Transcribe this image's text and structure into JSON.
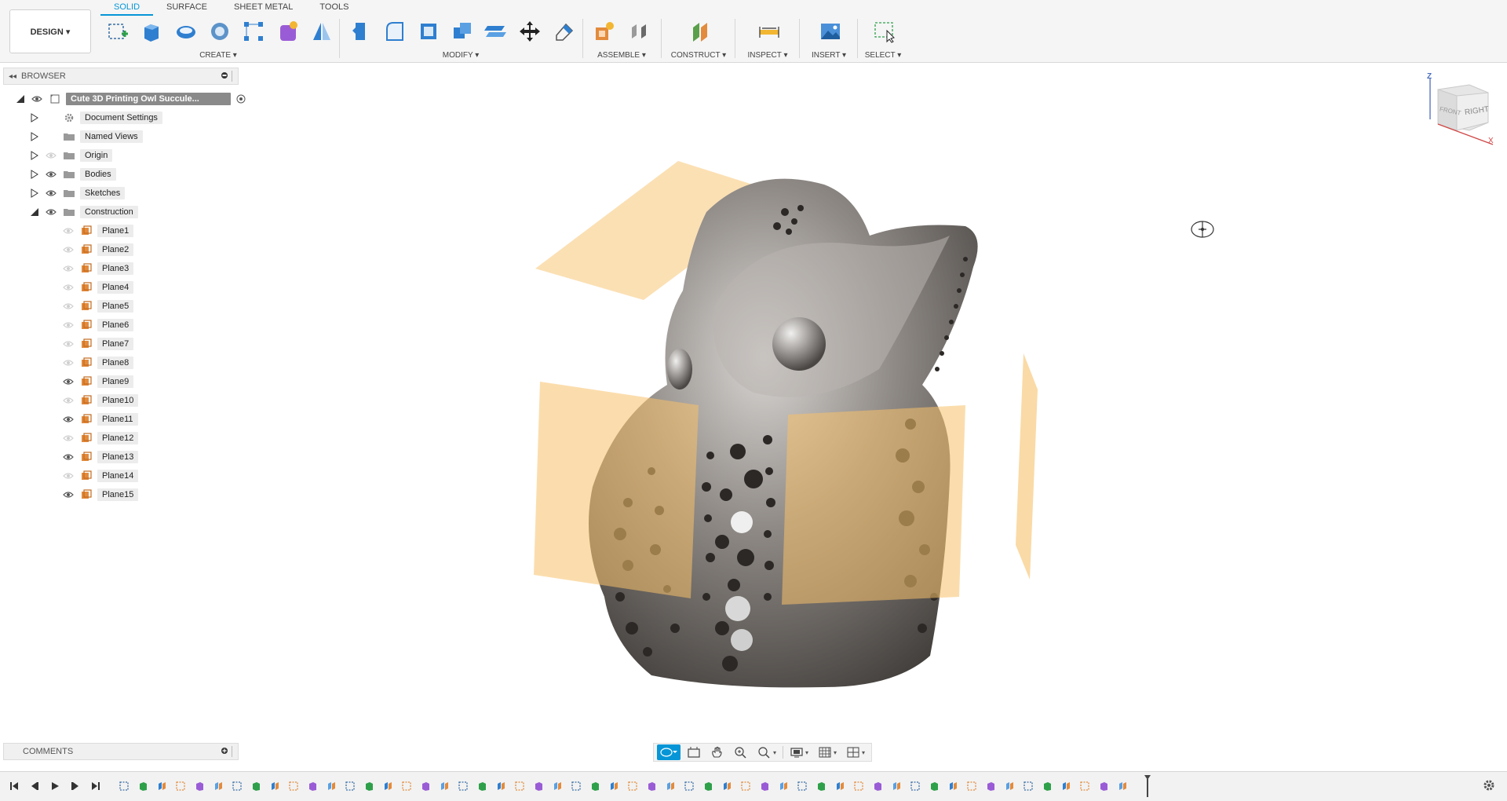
{
  "toolbar": {
    "workspace_button": "DESIGN ▾",
    "tabs": [
      "SOLID",
      "SURFACE",
      "SHEET METAL",
      "TOOLS"
    ],
    "groups": {
      "create": "CREATE ▾",
      "modify": "MODIFY ▾",
      "assemble": "ASSEMBLE ▾",
      "construct": "CONSTRUCT ▾",
      "inspect": "INSPECT ▾",
      "insert": "INSERT ▾",
      "select": "SELECT ▾"
    }
  },
  "browser": {
    "title": "BROWSER",
    "root": "Cute 3D Printing Owl Succule...",
    "items": [
      {
        "label": "Document Settings"
      },
      {
        "label": "Named Views"
      },
      {
        "label": "Origin"
      },
      {
        "label": "Bodies"
      },
      {
        "label": "Sketches"
      },
      {
        "label": "Construction"
      }
    ],
    "planes": [
      {
        "label": "Plane1",
        "visible": false
      },
      {
        "label": "Plane2",
        "visible": false
      },
      {
        "label": "Plane3",
        "visible": false
      },
      {
        "label": "Plane4",
        "visible": false
      },
      {
        "label": "Plane5",
        "visible": false
      },
      {
        "label": "Plane6",
        "visible": false
      },
      {
        "label": "Plane7",
        "visible": false
      },
      {
        "label": "Plane8",
        "visible": false
      },
      {
        "label": "Plane9",
        "visible": true
      },
      {
        "label": "Plane10",
        "visible": false
      },
      {
        "label": "Plane11",
        "visible": true
      },
      {
        "label": "Plane12",
        "visible": false
      },
      {
        "label": "Plane13",
        "visible": true
      },
      {
        "label": "Plane14",
        "visible": false
      },
      {
        "label": "Plane15",
        "visible": true
      }
    ]
  },
  "viewcube": {
    "front": "FRONT",
    "right": "RIGHT",
    "z": "Z",
    "x": "X"
  },
  "comments": {
    "title": "COMMENTS"
  },
  "colors": {
    "accent": "#0696d7",
    "plane": "#f7c16a",
    "body": "#8a8580"
  }
}
